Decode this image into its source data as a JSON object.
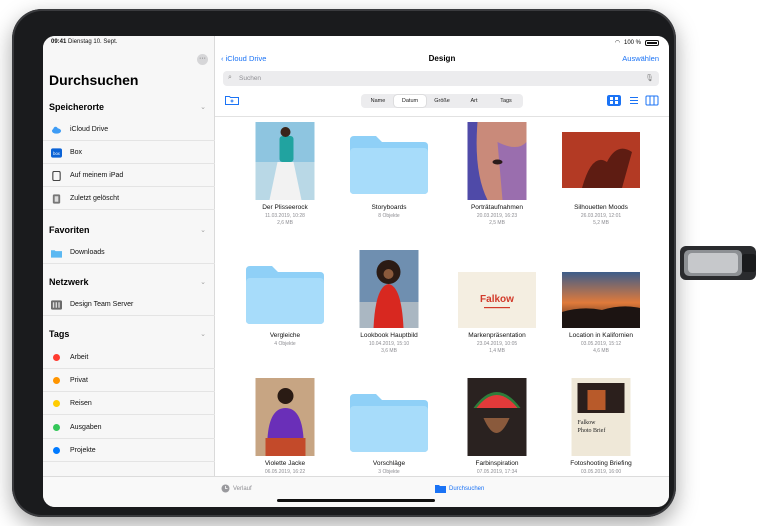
{
  "status": {
    "time": "09:41",
    "date": "Dienstag 10. Sept.",
    "battery": "100 %"
  },
  "sidebar": {
    "title": "Durchsuchen",
    "sections": [
      {
        "label": "Speicherorte",
        "items": [
          {
            "label": "iCloud Drive",
            "icon": "cloud-icon"
          },
          {
            "label": "Box",
            "icon": "box-icon"
          },
          {
            "label": "Auf meinem iPad",
            "icon": "ipad-icon"
          },
          {
            "label": "Zuletzt gelöscht",
            "icon": "trash-icon"
          }
        ]
      },
      {
        "label": "Favoriten",
        "items": [
          {
            "label": "Downloads",
            "icon": "folder-icon"
          }
        ]
      },
      {
        "label": "Netzwerk",
        "items": [
          {
            "label": "Design Team Server",
            "icon": "server-icon"
          }
        ]
      },
      {
        "label": "Tags",
        "items": [
          {
            "label": "Arbeit",
            "color": "#ff3b30"
          },
          {
            "label": "Privat",
            "color": "#ff9500"
          },
          {
            "label": "Reisen",
            "color": "#ffcc00"
          },
          {
            "label": "Ausgaben",
            "color": "#34c759"
          },
          {
            "label": "Projekte",
            "color": "#007aff"
          }
        ]
      }
    ]
  },
  "nav": {
    "back_label": "iCloud Drive",
    "title": "Design",
    "action_label": "Auswählen"
  },
  "search": {
    "placeholder": "Suchen"
  },
  "sort": {
    "options": [
      "Name",
      "Datum",
      "Größe",
      "Art",
      "Tags"
    ],
    "selected": "Datum"
  },
  "files": [
    {
      "name": "Der Plisseerock",
      "date": "11.03.2019, 10:28",
      "size": "2,6 MB",
      "kind": "photo"
    },
    {
      "name": "Storyboards",
      "date": "",
      "size": "8 Objekte",
      "kind": "folder"
    },
    {
      "name": "Porträtaufnahmen",
      "date": "20.03.2019, 16:23",
      "size": "2,5 MB",
      "kind": "photo"
    },
    {
      "name": "Silhouetten Moods",
      "date": "26.03.2019, 12:01",
      "size": "5,2 MB",
      "kind": "photo"
    },
    {
      "name": "Vergleiche",
      "date": "",
      "size": "4 Objekte",
      "kind": "folder"
    },
    {
      "name": "Lookbook Hauptbild",
      "date": "10.04.2019, 15:10",
      "size": "3,6 MB",
      "kind": "photo"
    },
    {
      "name": "Markenpräsentation",
      "date": "23.04.2019, 10:05",
      "size": "1,4 MB",
      "kind": "doc"
    },
    {
      "name": "Location in Kalifornien",
      "date": "03.05.2019, 15:12",
      "size": "4,6 MB",
      "kind": "photo"
    },
    {
      "name": "Violette Jacke",
      "date": "06.05.2019, 16:22",
      "size": "",
      "kind": "photo"
    },
    {
      "name": "Vorschläge",
      "date": "",
      "size": "3 Objekte",
      "kind": "folder"
    },
    {
      "name": "Farbinspiration",
      "date": "07.05.2019, 17:34",
      "size": "",
      "kind": "photo"
    },
    {
      "name": "Fotoshooting Briefing",
      "date": "03.05.2019, 16:00",
      "size": "",
      "kind": "doc"
    }
  ],
  "thumb_text": {
    "brand": "Falkow",
    "brief_line1": "Falkow",
    "brief_line2": "Photo Brief"
  },
  "tabbar": {
    "recents_label": "Verlauf",
    "browse_label": "Durchsuchen"
  },
  "colors": {
    "accent": "#1b73f5",
    "folder": "#8fd0f7"
  }
}
